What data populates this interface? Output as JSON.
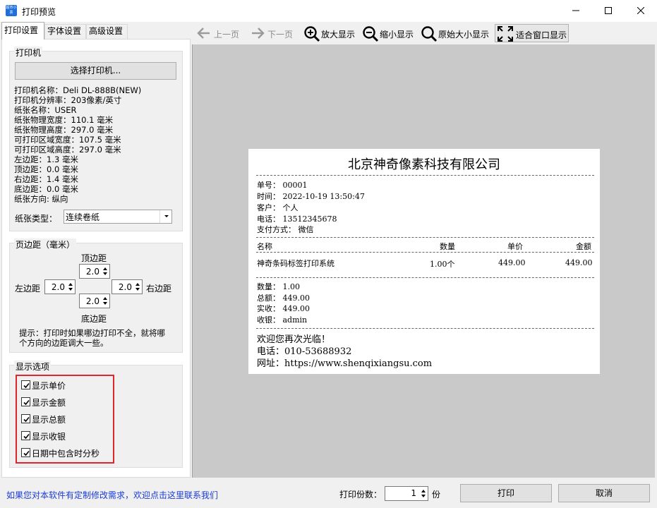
{
  "window": {
    "title": "打印预览",
    "icon_text": "超市小票"
  },
  "tabs": [
    "打印设置",
    "字体设置",
    "高级设置"
  ],
  "printer_group": {
    "title": "打印机",
    "select_button": "选择打印机...",
    "info": [
      "打印机名称：Deli DL-888B(NEW)",
      "打印机分辨率：203像素/英寸",
      "纸张名称：USER",
      "纸张物理宽度：110.1 毫米",
      "纸张物理高度：297.0 毫米",
      "可打印区域宽度：107.5 毫米",
      "可打印区域高度：297.0 毫米",
      "左边距：1.3 毫米",
      "顶边距：0.0 毫米",
      "右边距：1.4 毫米",
      "底边距：0.0 毫米",
      "纸张方向: 纵向"
    ],
    "paper_type_label": "纸张类型：",
    "paper_type_value": "连续卷纸"
  },
  "margin_group": {
    "title": "页边距（毫米）",
    "top_label": "顶边距",
    "top_value": "2.0",
    "left_label": "左边距",
    "left_value": "2.0",
    "right_label": "右边距",
    "right_value": "2.0",
    "bottom_label": "底边距",
    "bottom_value": "2.0",
    "hint_line1": "提示：打印时如果哪边打印不全，就将哪",
    "hint_line2": "个方向的边距调大一些。"
  },
  "display_group": {
    "title": "显示选项",
    "options": [
      {
        "label": "显示单价",
        "checked": true
      },
      {
        "label": "显示金额",
        "checked": true
      },
      {
        "label": "显示总额",
        "checked": true
      },
      {
        "label": "显示收银",
        "checked": true
      },
      {
        "label": "日期中包含时分秒",
        "checked": true
      }
    ]
  },
  "toolbar": {
    "prev": "上一页",
    "next": "下一页",
    "zoom_in": "放大显示",
    "zoom_out": "缩小显示",
    "original": "原始大小显示",
    "fit": "适合窗口显示"
  },
  "receipt": {
    "company": "北京神奇像素科技有限公司",
    "header": [
      "单号：  00001",
      "时间：  2022-10-19 13:50:47",
      "客户：  个人",
      "电话：  13512345678",
      "支付方式：  微信"
    ],
    "columns": [
      "名称",
      "数量",
      "单价",
      "金额"
    ],
    "items": [
      {
        "name": "神奇条码标签打印系统",
        "qty": "1.00个",
        "price": "449.00",
        "amount": "449.00"
      }
    ],
    "summary": [
      "数量：  1.00",
      "总额：  449.00",
      "实收：  449.00",
      "收银：  admin"
    ],
    "footer": [
      "欢迎您再次光临！",
      "电话：010-53688932",
      "网址：https://www.shenqixiangsu.com"
    ]
  },
  "bottom": {
    "link": "如果您对本软件有定制修改需求，欢迎点击这里联系我们",
    "copies_label": "打印份数：",
    "copies_value": "1",
    "copies_unit": "份",
    "print_button": "打印",
    "cancel_button": "取消"
  },
  "colors": {
    "highlight": "#e0252c",
    "link": "#1a3bd6",
    "preview_bg": "#c9c9c9"
  }
}
